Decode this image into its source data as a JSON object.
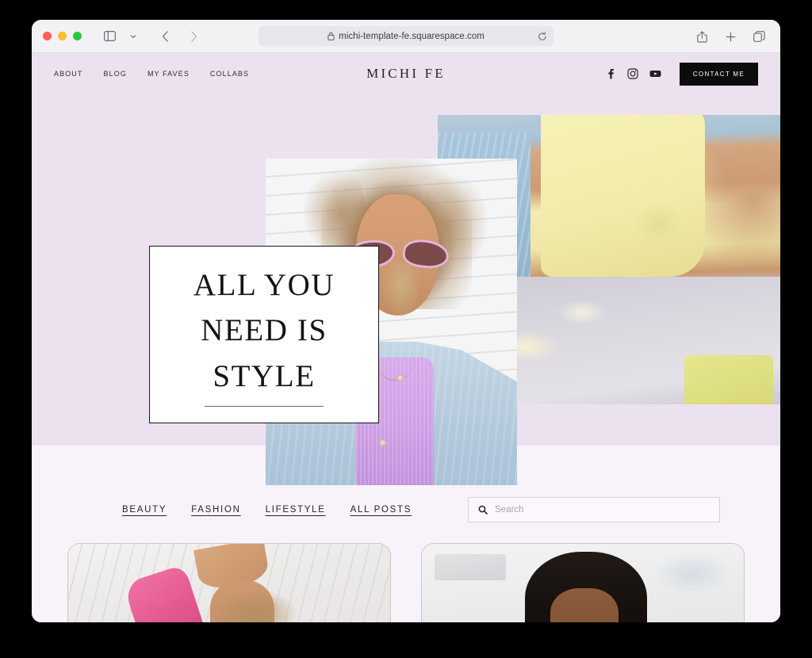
{
  "browser": {
    "url": "michi-template-fe.squarespace.com",
    "icons": {
      "lock": "lock-icon",
      "reload": "reload-icon",
      "sidebar": "sidebar-toggle-icon",
      "sidebar_chevron": "chevron-down-icon",
      "back": "back-arrow-icon",
      "forward": "forward-arrow-icon",
      "share": "share-icon",
      "new_tab": "plus-icon",
      "tabs": "tab-overview-icon"
    },
    "traffic_lights": {
      "close": "#ff5f57",
      "minimize": "#febc2e",
      "maximize": "#28c840"
    }
  },
  "site": {
    "brand": "MICHI FE",
    "nav": [
      {
        "label": "ABOUT"
      },
      {
        "label": "BLOG"
      },
      {
        "label": "MY FAVES"
      },
      {
        "label": "COLLABS"
      }
    ],
    "social": [
      {
        "name": "facebook-icon"
      },
      {
        "name": "instagram-icon"
      },
      {
        "name": "youtube-icon"
      }
    ],
    "contact_button": "CONTACT ME"
  },
  "hero": {
    "line1": "ALL YOU",
    "line2": "NEED IS",
    "line3": "STYLE",
    "background_color": "#ece2ef",
    "card_background": "#ffffff",
    "card_border": "#17151a"
  },
  "filters": {
    "categories": [
      {
        "label": "BEAUTY"
      },
      {
        "label": "FASHION"
      },
      {
        "label": "LIFESTYLE"
      },
      {
        "label": "ALL POSTS"
      }
    ]
  },
  "search": {
    "placeholder": "Search",
    "value": "",
    "icon": "search-icon"
  },
  "posts": [
    {
      "name": "post-card-left"
    },
    {
      "name": "post-card-right"
    }
  ],
  "colors": {
    "page_background": "#f8f3f9",
    "hero_background": "#ece2ef",
    "accent_dark": "#0d0b0e",
    "toolbar": "#f2f1f3"
  }
}
